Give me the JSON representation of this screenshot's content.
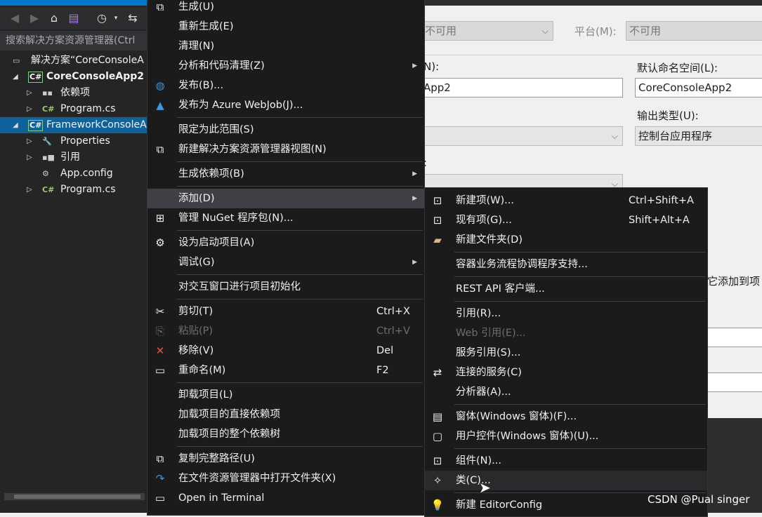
{
  "solution_explorer": {
    "toolbar_icons": [
      "back-icon",
      "forward-icon",
      "home-icon",
      "vs-switch-view-icon",
      "history-icon",
      "sync-icon"
    ],
    "search_placeholder": "搜索解决方案资源管理器(Ctrl",
    "tree": [
      {
        "label": "解决方案“CoreConsoleA",
        "icon": "solution-icon",
        "level": 0,
        "expander": "none"
      },
      {
        "label": "CoreConsoleApp2",
        "icon": "csharp-project-icon",
        "level": 1,
        "expander": "expanded",
        "bold": true
      },
      {
        "label": "依赖项",
        "icon": "dependencies-icon",
        "level": 2,
        "expander": "collapsed"
      },
      {
        "label": "Program.cs",
        "icon": "csharp-file-icon",
        "level": 2,
        "expander": "collapsed"
      },
      {
        "label": "FrameworkConsoleA",
        "icon": "csharp-project-icon",
        "level": 1,
        "expander": "expanded",
        "selected": true
      },
      {
        "label": "Properties",
        "icon": "wrench-icon",
        "level": 2,
        "expander": "collapsed"
      },
      {
        "label": "引用",
        "icon": "references-icon",
        "level": 2,
        "expander": "collapsed"
      },
      {
        "label": "App.config",
        "icon": "config-file-icon",
        "level": 2,
        "expander": "none"
      },
      {
        "label": "Program.cs",
        "icon": "csharp-file-icon",
        "level": 2,
        "expander": "collapsed"
      }
    ]
  },
  "properties_page": {
    "config_value": "不可用",
    "platform_label": "平台(M):",
    "platform_value": "不可用",
    "assembly_name_label_partial": "N):",
    "assembly_name_value_partial": "App2",
    "default_namespace_label": "默认命名空间(L):",
    "default_namespace_value": "CoreConsoleApp2",
    "output_type_label": "输出类型(U):",
    "output_type_value": "控制台应用程序",
    "startup_label_partial": ":",
    "partial_text": "它添加到项"
  },
  "context_menu": [
    {
      "label": "生成(U)",
      "icon": "build-icon"
    },
    {
      "label": "重新生成(E)"
    },
    {
      "label": "清理(N)"
    },
    {
      "label": "分析和代码清理(Z)",
      "submenu": true
    },
    {
      "label": "发布(B)...",
      "icon": "publish-globe-icon"
    },
    {
      "label": "发布为 Azure WebJob(J)...",
      "icon": "azure-icon"
    },
    {
      "sep": true
    },
    {
      "label": "限定为此范围(S)"
    },
    {
      "label": "新建解决方案资源管理器视图(N)",
      "icon": "new-view-icon"
    },
    {
      "sep": true
    },
    {
      "label": "生成依赖项(B)",
      "submenu": true
    },
    {
      "sep": true
    },
    {
      "label": "添加(D)",
      "submenu": true,
      "highlighted": true
    },
    {
      "label": "管理 NuGet 程序包(N)...",
      "icon": "nuget-icon"
    },
    {
      "sep": true
    },
    {
      "label": "设为启动项目(A)",
      "icon": "gear-icon"
    },
    {
      "label": "调试(G)",
      "submenu": true
    },
    {
      "sep": true
    },
    {
      "label": "对交互窗口进行项目初始化"
    },
    {
      "sep": true
    },
    {
      "label": "剪切(T)",
      "icon": "scissors-icon",
      "shortcut": "Ctrl+X"
    },
    {
      "label": "粘贴(P)",
      "icon": "paste-icon",
      "shortcut": "Ctrl+V",
      "disabled": true
    },
    {
      "label": "移除(V)",
      "icon": "remove-x-icon",
      "shortcut": "Del"
    },
    {
      "label": "重命名(M)",
      "icon": "rename-icon",
      "shortcut": "F2"
    },
    {
      "sep": true
    },
    {
      "label": "卸载项目(L)"
    },
    {
      "label": "加载项目的直接依赖项"
    },
    {
      "label": "加载项目的整个依赖树"
    },
    {
      "sep": true
    },
    {
      "label": "复制完整路径(U)",
      "icon": "copy-icon"
    },
    {
      "label": "在文件资源管理器中打开文件夹(X)",
      "icon": "open-folder-arrow-icon"
    },
    {
      "label": "Open in Terminal",
      "icon": "terminal-icon"
    }
  ],
  "add_submenu": [
    {
      "label": "新建项(W)...",
      "icon": "new-item-icon",
      "shortcut": "Ctrl+Shift+A"
    },
    {
      "label": "现有项(G)...",
      "icon": "existing-item-icon",
      "shortcut": "Shift+Alt+A"
    },
    {
      "label": "新建文件夹(D)",
      "icon": "new-folder-icon"
    },
    {
      "sep": true
    },
    {
      "label": "容器业务流程协调程序支持..."
    },
    {
      "sep": true
    },
    {
      "label": "REST API 客户端..."
    },
    {
      "sep": true
    },
    {
      "label": "引用(R)..."
    },
    {
      "label": "Web 引用(E)...",
      "disabled": true
    },
    {
      "label": "服务引用(S)..."
    },
    {
      "label": "连接的服务(C)",
      "icon": "connected-service-icon"
    },
    {
      "label": "分析器(A)..."
    },
    {
      "sep": true
    },
    {
      "label": "窗体(Windows 窗体)(F)...",
      "icon": "form-icon"
    },
    {
      "label": "用户控件(Windows 窗体)(U)...",
      "icon": "user-control-icon"
    },
    {
      "sep": true
    },
    {
      "label": "组件(N)...",
      "icon": "component-icon"
    },
    {
      "label": "类(C)...",
      "icon": "class-icon",
      "hovered": true
    },
    {
      "sep": true
    },
    {
      "label": "新建 EditorConfig",
      "icon": "lightbulb-icon"
    }
  ],
  "watermark": "CSDN @Pual singer",
  "colors": {
    "accent": "#007acc",
    "selection": "#0e639c",
    "menu_bg": "#1b1b1c",
    "menu_highlight": "#3f3f46",
    "remove_icon": "#e8543c",
    "publish_icon": "#3a96dd"
  }
}
